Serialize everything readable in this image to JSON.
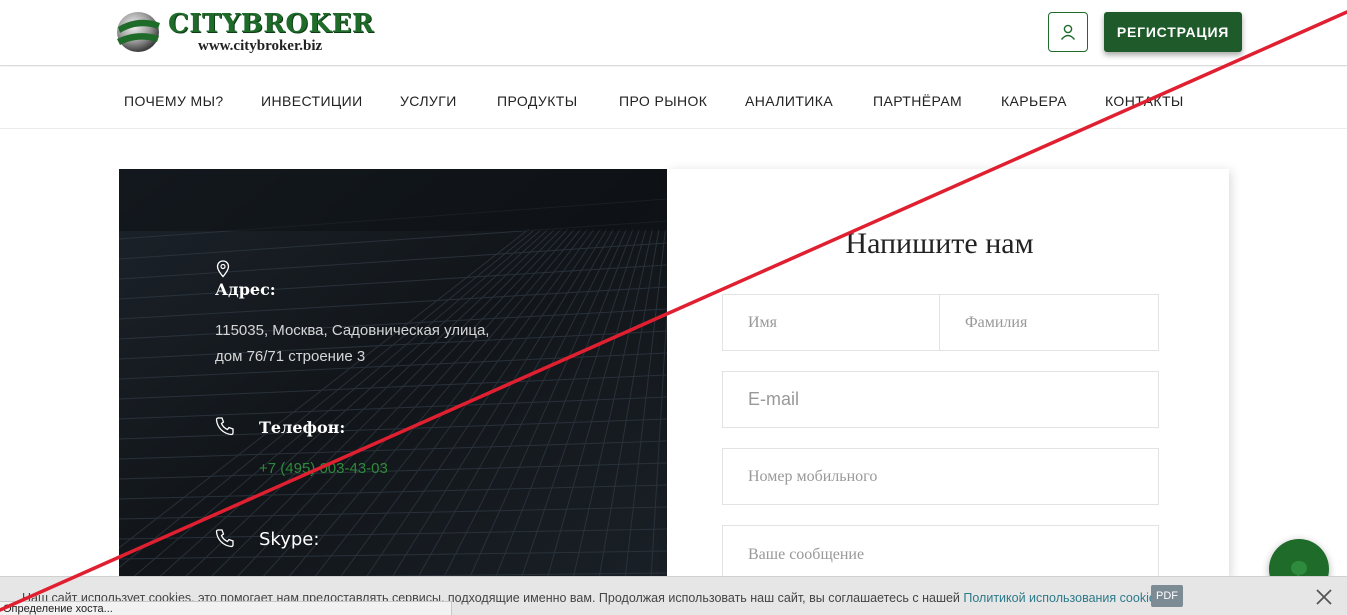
{
  "colors": {
    "brand_green": "#1e6b2a",
    "button_green": "#1e5a2a",
    "link_green": "#2d8a3a",
    "cookie_link": "#2d7a8a",
    "strike_red": "#e02030"
  },
  "header": {
    "logo_name": "CITYBROKER",
    "logo_url": "www.citybroker.biz",
    "user_icon": "user-icon",
    "register_label": "РЕГИСТРАЦИЯ"
  },
  "nav": {
    "items": [
      "ПОЧЕМУ МЫ?",
      "ИНВЕСТИЦИИ",
      "УСЛУГИ",
      "ПРОДУКТЫ",
      "ПРО РЫНОК",
      "АНАЛИТИКА",
      "ПАРТНЁРАМ",
      "КАРЬЕРА",
      "КОНТАКТЫ"
    ]
  },
  "contacts": {
    "address_label": "Адрес:",
    "address_line1": "115035, Москва, Садовническая улица,",
    "address_line2": "дом 76/71 строение 3",
    "phone_label": "Телефон:",
    "phone_value": "+7 (495) 003-43-03",
    "skype_label": "Skype:"
  },
  "form": {
    "title": "Напишите нам",
    "first_name_placeholder": "Имя",
    "last_name_placeholder": "Фамилия",
    "email_placeholder": "E-mail",
    "phone_placeholder": "Номер мобильного",
    "message_placeholder": "Ваше сообщение"
  },
  "cookie": {
    "text": "Наш сайт использует cookies, это помогает нам предоставлять сервисы, подходящие именно вам. Продолжая использовать наш сайт, вы соглашаетесь с нашей",
    "link": "Политикой использования cookies",
    "badge": "PDF"
  },
  "status_bar": {
    "text": "Определение хоста..."
  }
}
